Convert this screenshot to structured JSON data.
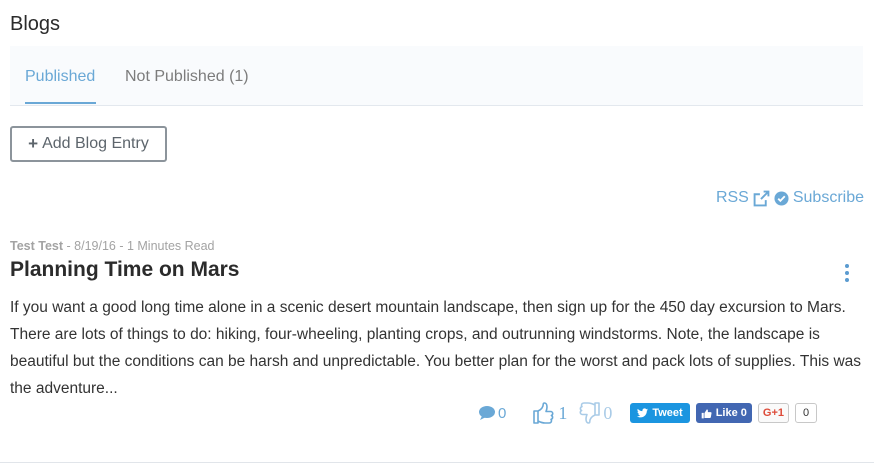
{
  "page": {
    "title": "Blogs"
  },
  "tabs": [
    {
      "label": "Published",
      "active": true
    },
    {
      "label": "Not Published (1)",
      "active": false
    }
  ],
  "toolbar": {
    "add_label": "Add Blog Entry",
    "add_icon": "plus-icon"
  },
  "feed": {
    "rss_label": "RSS",
    "rss_icon": "external-link-icon",
    "subscribe_label": "Subscribe",
    "subscribe_icon": "check-circle-icon"
  },
  "post": {
    "author": "Test Test",
    "meta_rest": " - 8/19/16 - 1 Minutes Read",
    "title": "Planning Time on Mars",
    "excerpt": "If you want a good long time alone in a scenic desert mountain landscape, then sign up for the 450 day excursion to Mars. There are lots of things to do: hiking, four-wheeling, planting crops, and outrunning windstorms. Note, the landscape is beautiful but the conditions can be harsh and unpredictable. You better plan for the worst and pack lots of supplies. This was the adventure...",
    "comments_count": "0",
    "likes_count": "1",
    "dislikes_count": "0"
  },
  "social": {
    "tweet_label": "Tweet",
    "like_label": "Like 0",
    "gplus_label": "G+1",
    "gplus_count": "0"
  },
  "colors": {
    "accent": "#6aa8d6",
    "twitter": "#1b95e0",
    "facebook": "#4267b2",
    "gplus": "#dd4b39"
  }
}
